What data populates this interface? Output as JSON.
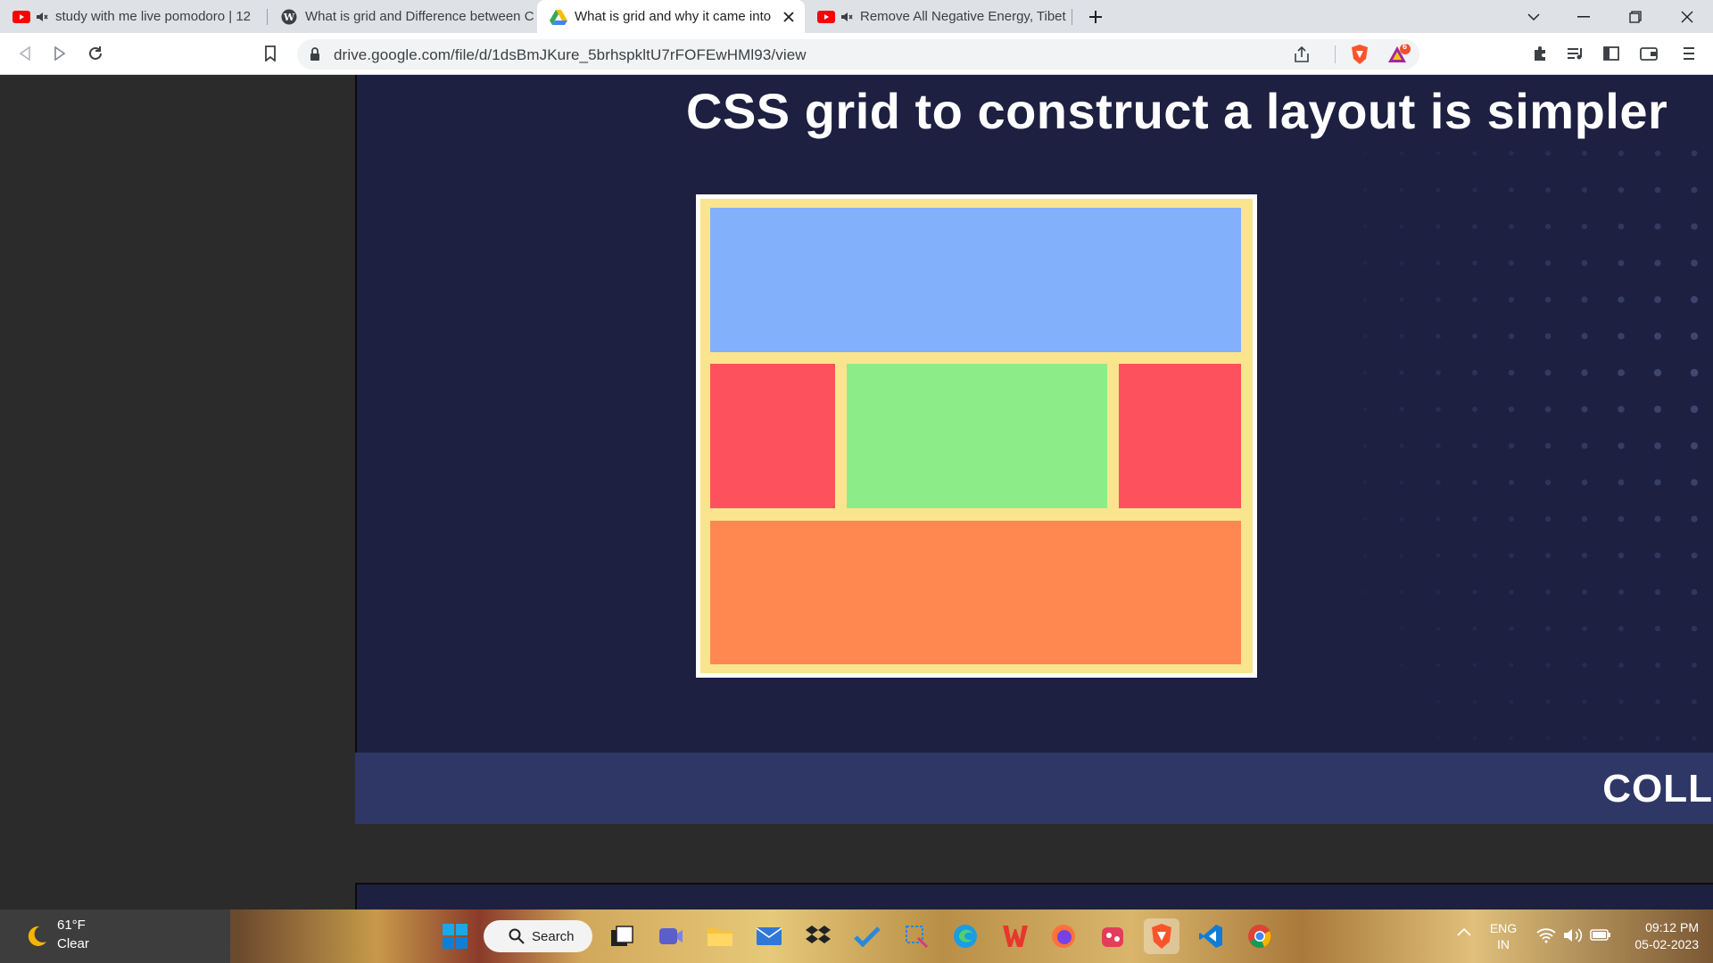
{
  "browser": {
    "tabs": [
      {
        "title": "study with me live pomodoro | 12",
        "icon": "youtube-icon",
        "muted": true
      },
      {
        "title": "What is grid and Difference between C",
        "icon": "wordpress-icon",
        "muted": false
      },
      {
        "title": "What is grid and why it came into",
        "icon": "google-drive-icon",
        "muted": false,
        "active": true
      },
      {
        "title": "Remove All Negative Energy, Tibet",
        "icon": "youtube-icon",
        "muted": true
      }
    ],
    "url": "drive.google.com/file/d/1dsBmJKure_5brhspkltU7rFOFEwHMl93/view",
    "brave_rewards_badge": "6"
  },
  "slide": {
    "headline": "CSS grid to construct a layout is simpler",
    "footer_text": "COLL",
    "grid_colors": {
      "frame": "#fbe48e",
      "header": "#83b0fb",
      "side": "#fd525d",
      "main": "#8ced88",
      "footer": "#ff8851"
    }
  },
  "taskbar": {
    "weather_temp": "61°F",
    "weather_condition": "Clear",
    "search_label": "Search",
    "language": "ENG",
    "region": "IN",
    "time": "09:12 PM",
    "date": "05-02-2023"
  }
}
